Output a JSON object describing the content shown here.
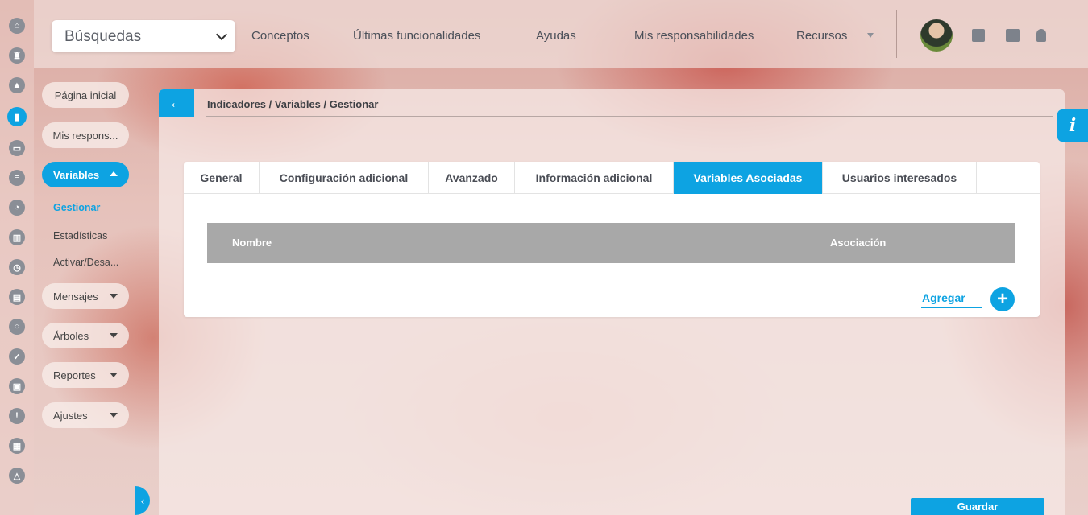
{
  "topbar": {
    "search_label": "Búsquedas",
    "nav": [
      "Conceptos",
      "Últimas funcionalidades",
      "Ayudas",
      "Mis responsabilidades",
      "Recursos"
    ]
  },
  "rail": {
    "icons": [
      "home-icon",
      "castle-icon",
      "pyramid-icon",
      "chart-icon",
      "presentation-icon",
      "list-icon",
      "pie-icon",
      "books-icon",
      "clock-icon",
      "document-icon",
      "cycle-icon",
      "check-icon",
      "briefcase-icon",
      "warning-icon",
      "calendar-icon",
      "network-icon"
    ]
  },
  "sidebar": {
    "home": "Página inicial",
    "responsibilities": "Mis respons...",
    "variables": "Variables",
    "sub_items": [
      "Gestionar",
      "Estadísticas",
      "Activar/Desa..."
    ],
    "mensajes": "Mensajes",
    "arboles": "Árboles",
    "reportes": "Reportes",
    "ajustes": "Ajustes"
  },
  "main": {
    "breadcrumb": "Indicadores / Variables / Gestionar",
    "tabs": [
      "General",
      "Configuración adicional",
      "Avanzado",
      "Información adicional",
      "Variables Asociadas",
      "Usuarios interesados"
    ],
    "active_tab": "Variables Asociadas",
    "grid_columns": [
      "Nombre",
      "Asociación"
    ],
    "add_label": "Agregar",
    "save_label": "Guardar"
  },
  "colors": {
    "accent": "#0da3e2",
    "grid_header": "#a8a8a8"
  }
}
